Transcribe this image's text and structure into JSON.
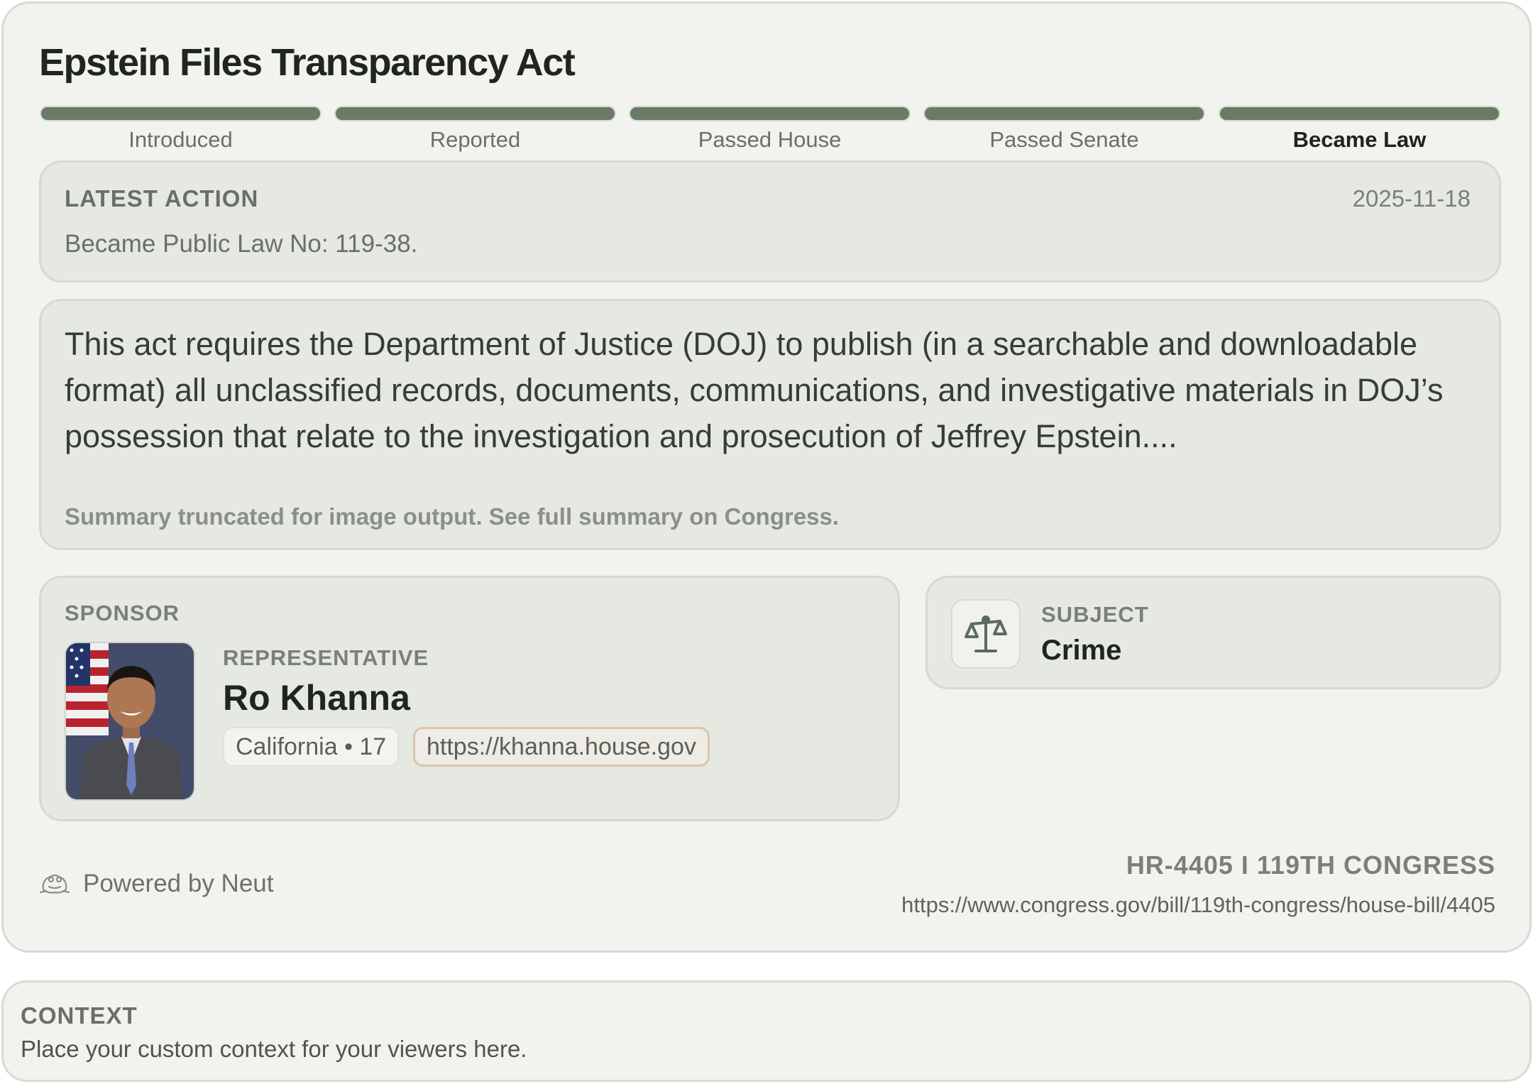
{
  "bill": {
    "title": "Epstein Files Transparency Act",
    "id_line": "HR-4405 I 119TH CONGRESS",
    "url": "https://www.congress.gov/bill/119th-congress/house-bill/4405"
  },
  "progress": {
    "stages": [
      "Introduced",
      "Reported",
      "Passed House",
      "Passed Senate",
      "Became Law"
    ],
    "current_stage": "Became Law"
  },
  "latest_action": {
    "heading": "LATEST ACTION",
    "date": "2025-11-18",
    "text": "Became Public Law No: 119-38."
  },
  "summary": {
    "text": "This act requires the Department of Justice (DOJ) to publish (in a searchable and downloadable format) all unclassified records, documents, communications, and investigative materials in DOJ’s possession that relate to the investigation and prosecution of Jeffrey Epstein....",
    "note": "Summary truncated for image output. See full summary on Congress."
  },
  "sponsor": {
    "heading": "SPONSOR",
    "role": "REPRESENTATIVE",
    "name": "Ro Khanna",
    "district": "California • 17",
    "website": "https://khanna.house.gov"
  },
  "subject": {
    "heading": "SUBJECT",
    "value": "Crime",
    "icon": "scales-icon"
  },
  "footer": {
    "powered_by": "Powered by Neut",
    "icon": "frog-logo-icon"
  },
  "context": {
    "heading": "CONTEXT",
    "text": "Place your custom context for your viewers here."
  },
  "colors": {
    "card_bg": "#f2f3ef",
    "panel_bg": "#e6e8e2",
    "progress_fill": "#6b7a66",
    "url_chip_border": "#d9c6ad"
  }
}
